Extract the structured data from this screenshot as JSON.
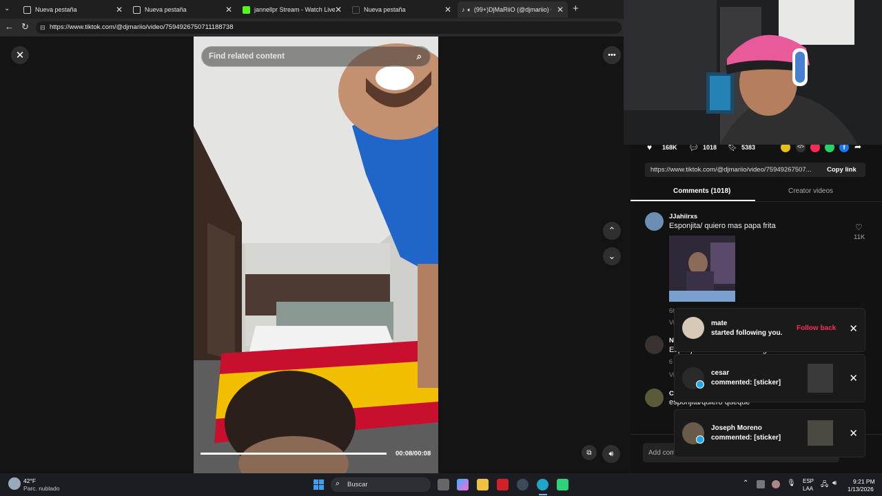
{
  "browser": {
    "tabs": [
      {
        "title": "Nueva pestaña"
      },
      {
        "title": "Nueva pestaña"
      },
      {
        "title": "jannellpr Stream - Watch Live on K"
      },
      {
        "title": "Nueva pestaña"
      },
      {
        "title": "(99+)DjMaRiiO (@djmariio) O"
      }
    ],
    "url": "https://www.tiktok.com/@djmariio/video/7594926750711188738"
  },
  "video": {
    "search_placeholder": "Find related content",
    "time": "00:08/00:08",
    "progress": 1.0
  },
  "actions": {
    "likes": "168K",
    "comments": "1018",
    "saves": "5383"
  },
  "share": {
    "link": "https://www.tiktok.com/@djmariio/video/75949267507...",
    "copy_label": "Copy link"
  },
  "tabs": {
    "comments": "Comments (1018)",
    "creator": "Creator videos"
  },
  "comments": [
    {
      "user": "JJahiirxs",
      "text": "Esponjita/ quiero mas papa frita",
      "likes": "11K",
      "meta": "6h ago  Reply",
      "view": "Vi"
    },
    {
      "user": "N",
      "text": "Esponjita absorbió todo el agua",
      "meta": "6",
      "view": "Vi"
    },
    {
      "user": "C",
      "text": "esponjita/quiero queque"
    }
  ],
  "add_comment": "Add com",
  "notifications": [
    {
      "name": "mate",
      "message": "started following you.",
      "action": "Follow back"
    },
    {
      "name": "cesar",
      "message": "commented: [sticker]"
    },
    {
      "name": "Joseph Moreno",
      "message": "commented: [sticker]"
    }
  ],
  "taskbar": {
    "weather_temp": "42°F",
    "weather_desc": "Parc. nublado",
    "search": "Buscar",
    "lang1": "ESP",
    "lang2": "LAA",
    "time": "9:21 PM",
    "date": "1/13/2026"
  },
  "colors": {
    "accent": "#fe2c55",
    "bg": "#121212"
  }
}
